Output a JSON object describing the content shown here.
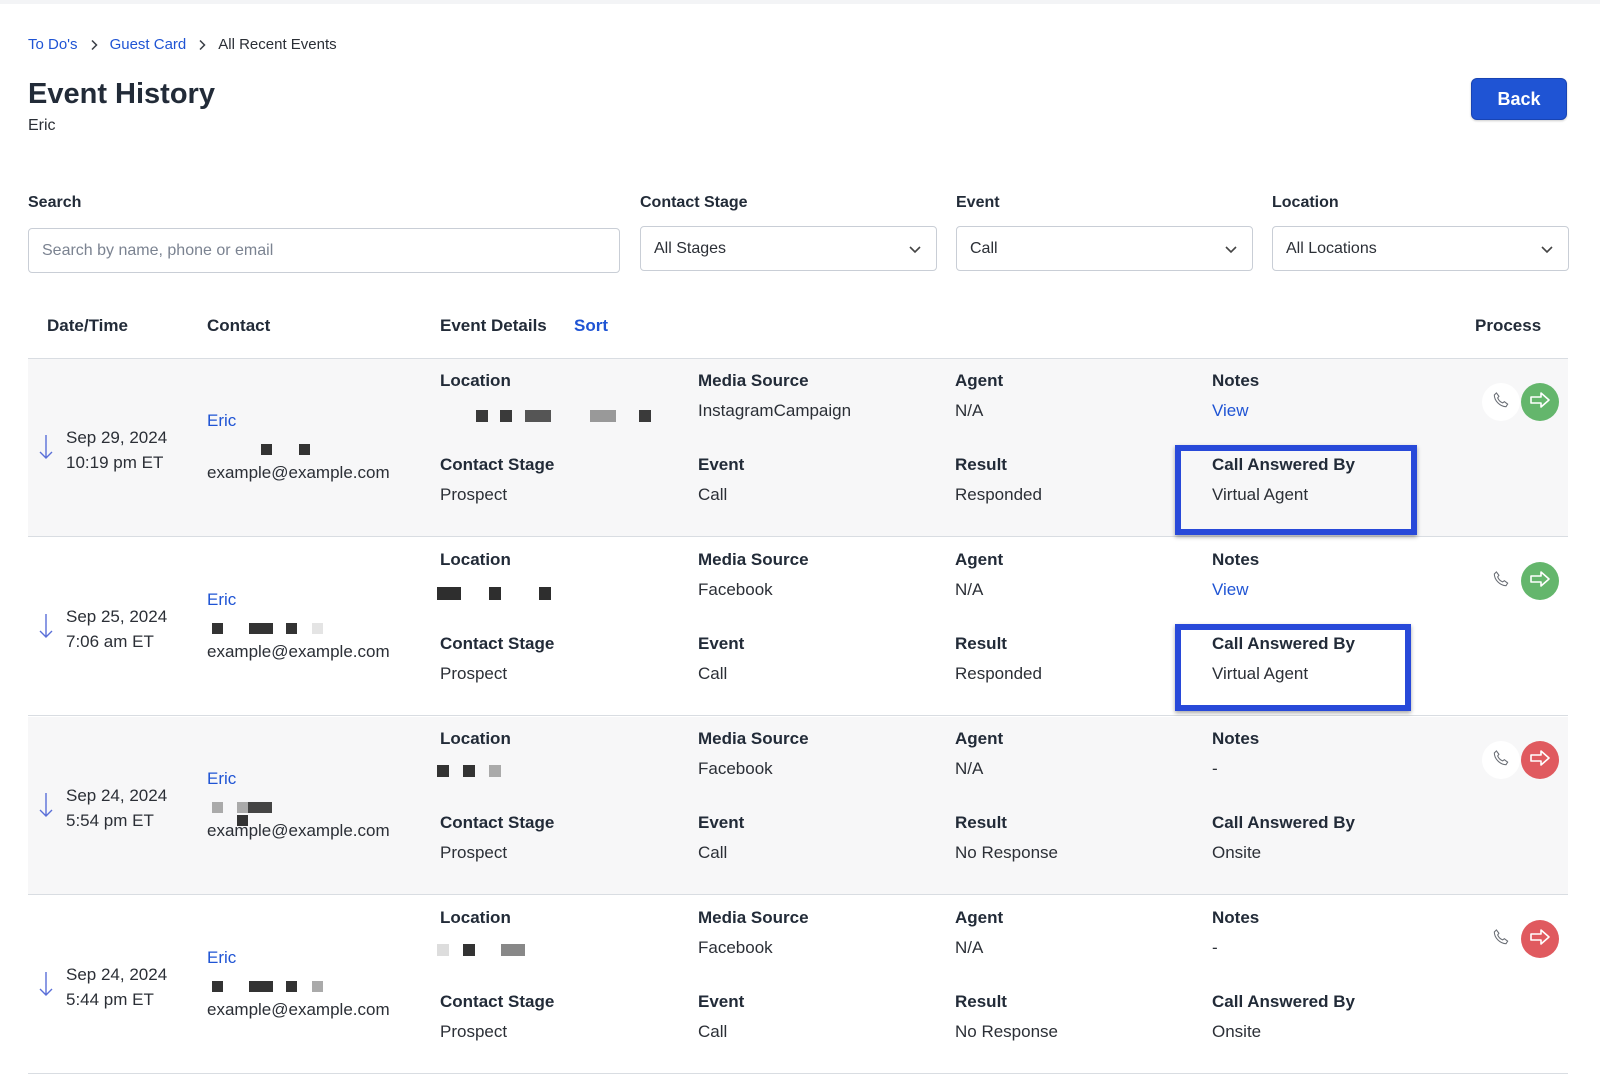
{
  "breadcrumb": {
    "item1": "To Do's",
    "item2": "Guest Card",
    "current": "All Recent Events"
  },
  "page": {
    "title": "Event History",
    "subtitle": "Eric",
    "back_label": "Back"
  },
  "filters": {
    "search_label": "Search",
    "search_placeholder": "Search by name, phone or email",
    "stage_label": "Contact Stage",
    "stage_value": "All Stages",
    "event_label": "Event",
    "event_value": "Call",
    "location_label": "Location",
    "location_value": "All Locations"
  },
  "table": {
    "headers": {
      "datetime": "Date/Time",
      "contact": "Contact",
      "details": "Event Details",
      "sort": "Sort",
      "process": "Process"
    },
    "field_labels": {
      "location": "Location",
      "media_source": "Media Source",
      "agent": "Agent",
      "notes": "Notes",
      "contact_stage": "Contact Stage",
      "event": "Event",
      "result": "Result",
      "call_answered_by": "Call Answered By"
    },
    "rows": [
      {
        "date": "Sep 29, 2024",
        "time": "10:19 pm ET",
        "name": "Eric",
        "email": "example@example.com",
        "media_source": "InstagramCampaign",
        "agent": "N/A",
        "notes": "View",
        "contact_stage": "Prospect",
        "event": "Call",
        "result": "Responded",
        "call_answered_by": "Virtual Agent",
        "process_status": "green"
      },
      {
        "date": "Sep 25, 2024",
        "time": "7:06 am ET",
        "name": "Eric",
        "email": "example@example.com",
        "media_source": "Facebook",
        "agent": "N/A",
        "notes": "View",
        "contact_stage": "Prospect",
        "event": "Call",
        "result": "Responded",
        "call_answered_by": "Virtual Agent",
        "process_status": "green"
      },
      {
        "date": "Sep 24, 2024",
        "time": "5:54 pm ET",
        "name": "Eric",
        "email": "example@example.com",
        "media_source": "Facebook",
        "agent": "N/A",
        "notes": "-",
        "contact_stage": "Prospect",
        "event": "Call",
        "result": "No Response",
        "call_answered_by": "Onsite",
        "process_status": "red"
      },
      {
        "date": "Sep 24, 2024",
        "time": "5:44 pm ET",
        "name": "Eric",
        "email": "example@example.com",
        "media_source": "Facebook",
        "agent": "N/A",
        "notes": "-",
        "contact_stage": "Prospect",
        "event": "Call",
        "result": "No Response",
        "call_answered_by": "Onsite",
        "process_status": "red"
      }
    ]
  },
  "colors": {
    "accent": "#1f54d4",
    "highlight_box": "#2849d9",
    "process_green": "#64b66c",
    "process_red": "#e05a5f"
  },
  "icons": {
    "breadcrumb_sep": "chevron-right-icon",
    "dropdown": "chevron-down-icon",
    "sort_direction": "arrow-down-icon",
    "call": "phone-icon",
    "process": "forward-arrow-icon"
  }
}
